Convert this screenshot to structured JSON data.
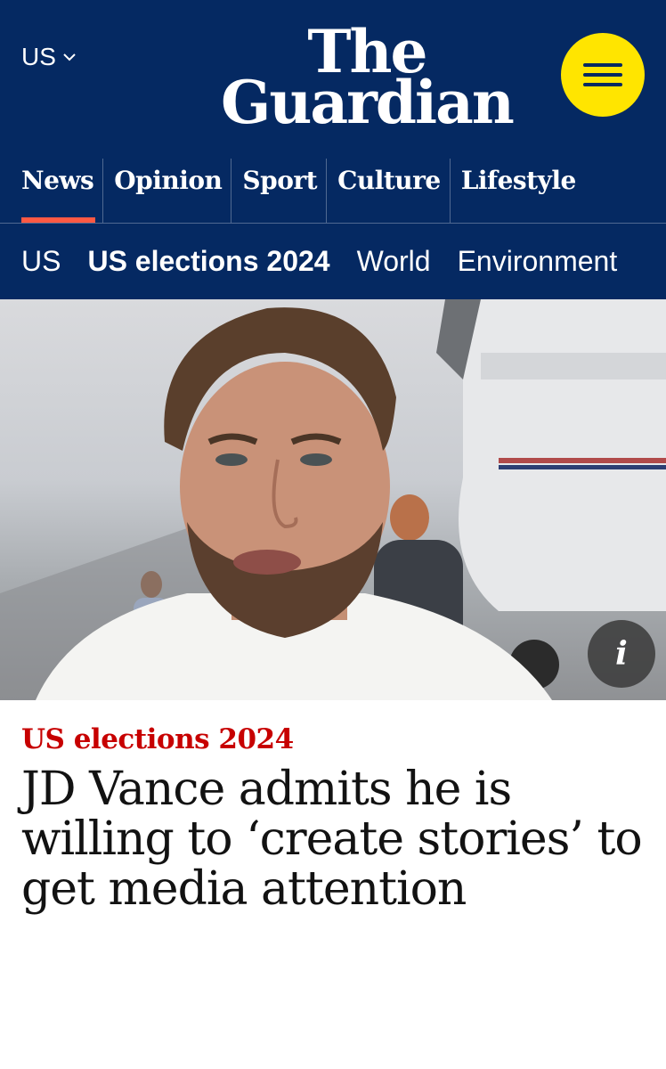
{
  "header": {
    "edition_label": "US",
    "logo_line1": "The",
    "logo_line2": "Guardian",
    "menu_icon": "hamburger-icon"
  },
  "pillars": [
    {
      "label": "News",
      "active": true
    },
    {
      "label": "Opinion",
      "active": false
    },
    {
      "label": "Sport",
      "active": false
    },
    {
      "label": "Culture",
      "active": false
    },
    {
      "label": "Lifestyle",
      "active": false
    }
  ],
  "subnav": [
    {
      "label": "US",
      "active": false
    },
    {
      "label": "US elections 2024",
      "active": true
    },
    {
      "label": "World",
      "active": false
    },
    {
      "label": "Environment",
      "active": false
    }
  ],
  "hero": {
    "info_glyph": "i"
  },
  "article": {
    "kicker": "US elections 2024",
    "headline": "JD Vance admits he is willing to ‘create stories’ to get media attention"
  },
  "colors": {
    "brand_blue": "#052962",
    "accent_yellow": "#ffe500",
    "news_red": "#c70000",
    "underline_red": "#ff5943"
  }
}
